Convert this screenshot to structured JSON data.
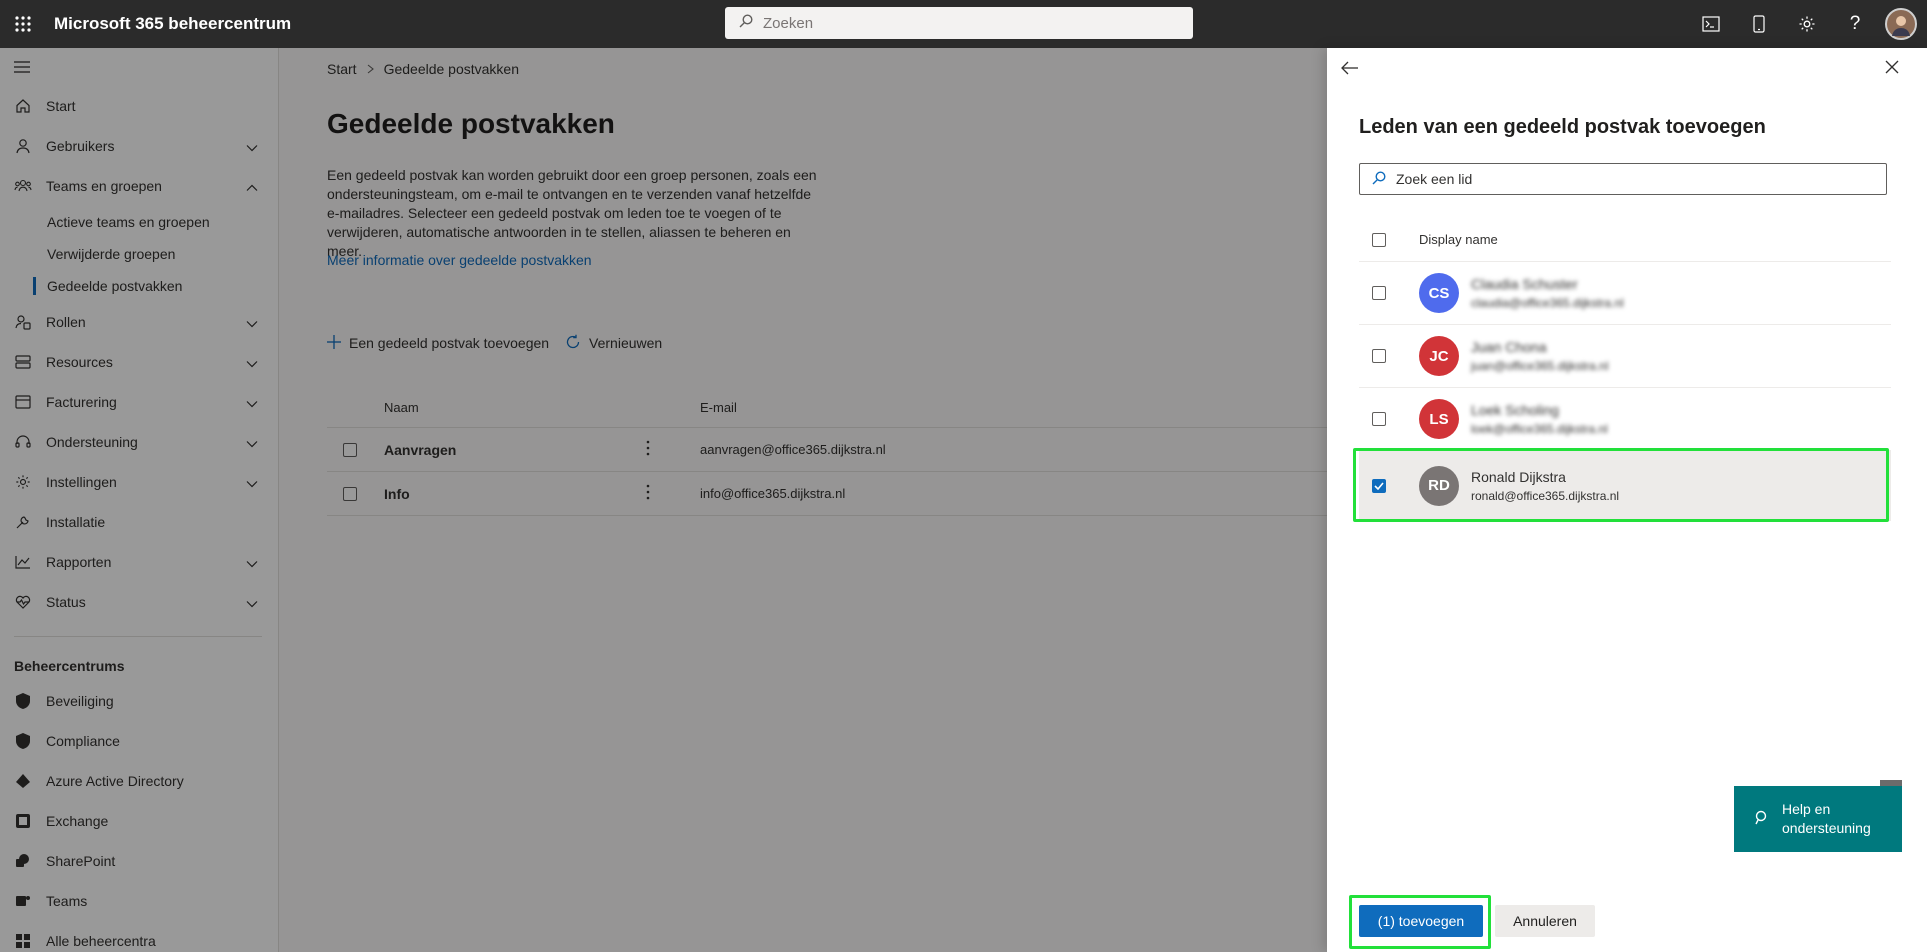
{
  "topbar": {
    "title": "Microsoft 365 beheercentrum",
    "search_placeholder": "Zoeken",
    "icons": [
      "terminal-icon",
      "mobile-icon",
      "gear-icon",
      "help-icon",
      "avatar"
    ]
  },
  "nav": {
    "items": [
      {
        "label": "Start",
        "icon": "home-icon"
      },
      {
        "label": "Gebruikers",
        "icon": "user-icon"
      },
      {
        "label": "Teams en groepen",
        "icon": "group-icon"
      },
      {
        "label": "Rollen",
        "icon": "roles-icon"
      },
      {
        "label": "Resources",
        "icon": "resources-icon"
      },
      {
        "label": "Facturering",
        "icon": "billing-icon"
      },
      {
        "label": "Ondersteuning",
        "icon": "headset-icon"
      },
      {
        "label": "Instellingen",
        "icon": "gear-icon"
      },
      {
        "label": "Installatie",
        "icon": "wrench-icon"
      },
      {
        "label": "Rapporten",
        "icon": "chart-icon"
      },
      {
        "label": "Status",
        "icon": "heart-icon"
      }
    ],
    "subitems": [
      "Actieve teams en groepen",
      "Verwijderde groepen",
      "Gedeelde postvakken"
    ],
    "section_title": "Beheercentrums",
    "admin_centers": [
      "Beveiliging",
      "Compliance",
      "Azure Active Directory",
      "Exchange",
      "SharePoint",
      "Teams",
      "Alle beheercentra"
    ]
  },
  "main": {
    "breadcrumb": [
      "Start",
      "Gedeelde postvakken"
    ],
    "title": "Gedeelde postvakken",
    "description": "Een gedeeld postvak kan worden gebruikt door een groep personen, zoals een ondersteuningsteam, om e-mail te ontvangen en te verzenden vanaf hetzelfde e-mailadres. Selecteer een gedeeld postvak om leden toe te voegen of te verwijderen, automatische antwoorden in te stellen, aliassen te beheren en meer.",
    "link": "Meer informatie over gedeelde postvakken",
    "add_label": "Een gedeeld postvak toevoegen",
    "refresh_label": "Vernieuwen",
    "columns": [
      "Naam",
      "E-mail"
    ],
    "rows": [
      {
        "name": "Aanvragen",
        "email": "aanvragen@office365.dijkstra.nl"
      },
      {
        "name": "Info",
        "email": "info@office365.dijkstra.nl"
      }
    ]
  },
  "panel": {
    "title": "Leden van een gedeeld postvak toevoegen",
    "search_placeholder": "Zoek een lid",
    "column": "Display name",
    "members": [
      {
        "initials": "CS",
        "name": "Claudia Schuster",
        "email": "claudia@office365.dijkstra.nl",
        "color": "#4f6bed",
        "selected": false,
        "blurred": true
      },
      {
        "initials": "JC",
        "name": "Juan Chona",
        "email": "juan@office365.dijkstra.nl",
        "color": "#d13438",
        "selected": false,
        "blurred": true
      },
      {
        "initials": "LS",
        "name": "Loek Scholing",
        "email": "loek@office365.dijkstra.nl",
        "color": "#d13438",
        "selected": false,
        "blurred": true
      },
      {
        "initials": "RD",
        "name": "Ronald Dijkstra",
        "email": "ronald@office365.dijkstra.nl",
        "color": "#7a7574",
        "selected": true,
        "blurred": false
      }
    ],
    "primary_button": "(1) toevoegen",
    "secondary_button": "Annuleren"
  },
  "help": {
    "label": "Help en ondersteuning"
  },
  "colors": {
    "accent": "#0f6cbd",
    "highlight": "#22e03a",
    "help": "#00797e"
  }
}
